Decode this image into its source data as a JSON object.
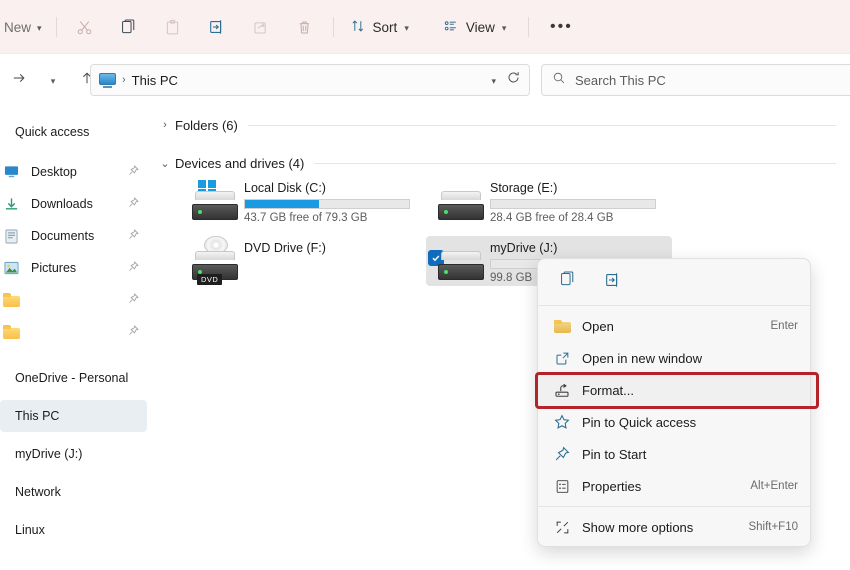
{
  "toolbar": {
    "new_label": "New",
    "new_icon": "chevron-down-icon",
    "cut_icon": "scissors-icon",
    "copy_icon": "copy-icon",
    "paste_icon": "paste-icon",
    "rename_icon": "rename-icon",
    "share_icon": "share-icon",
    "delete_icon": "trash-icon",
    "sort_label": "Sort",
    "sort_icon": "sort-arrows-icon",
    "view_label": "View",
    "view_icon": "view-list-icon",
    "more_label": "•••"
  },
  "addressbar": {
    "back_icon": "arrow-left-icon",
    "forward_icon": "arrow-right-icon",
    "recent_icon": "chevron-down-icon",
    "up_icon": "arrow-up-icon",
    "location_icon": "this-pc-icon",
    "crumb": "This PC",
    "crumb_separator": "›",
    "dropdown_icon": "chevron-down-icon",
    "refresh_icon": "refresh-icon"
  },
  "search": {
    "icon": "search-icon",
    "placeholder": "Search This PC"
  },
  "sidebar": {
    "items": [
      {
        "label": "Quick access",
        "icon": "none",
        "pinned": false,
        "selected": false
      },
      {
        "label": "Desktop",
        "icon": "desktop-icon",
        "pinned": true,
        "selected": false
      },
      {
        "label": "Downloads",
        "icon": "downloads-icon",
        "pinned": true,
        "selected": false
      },
      {
        "label": "Documents",
        "icon": "documents-icon",
        "pinned": true,
        "selected": false
      },
      {
        "label": "Pictures",
        "icon": "pictures-icon",
        "pinned": true,
        "selected": false
      },
      {
        "label": "",
        "icon": "folder-icon",
        "pinned": true,
        "selected": false
      },
      {
        "label": "",
        "icon": "folder-icon",
        "pinned": true,
        "selected": false
      },
      {
        "label": "OneDrive - Personal",
        "icon": "none",
        "pinned": false,
        "selected": false
      },
      {
        "label": "This PC",
        "icon": "none",
        "pinned": false,
        "selected": true
      },
      {
        "label": "myDrive (J:)",
        "icon": "none",
        "pinned": false,
        "selected": false
      },
      {
        "label": "Network",
        "icon": "none",
        "pinned": false,
        "selected": false
      },
      {
        "label": "Linux",
        "icon": "none",
        "pinned": false,
        "selected": false
      }
    ]
  },
  "content": {
    "groups": [
      {
        "title": "Folders (6)",
        "expanded": false,
        "chevron": "›"
      },
      {
        "title": "Devices and drives (4)",
        "expanded": true,
        "chevron": "⌄"
      }
    ],
    "drives": [
      {
        "name": "Local Disk (C:)",
        "icon": "windows-drive-icon",
        "sub": "43.7 GB free of 79.3 GB",
        "used_percent": 45,
        "show_bar": true,
        "selected": false,
        "checked": false
      },
      {
        "name": "Storage (E:)",
        "icon": "drive-icon",
        "sub": "28.4 GB free of 28.4 GB",
        "used_percent": 0,
        "show_bar": true,
        "selected": false,
        "checked": false
      },
      {
        "name": "DVD Drive (F:)",
        "icon": "dvd-drive-icon",
        "sub": "",
        "used_percent": 0,
        "show_bar": false,
        "selected": false,
        "checked": false,
        "badge": "DVD"
      },
      {
        "name": "myDrive (J:)",
        "icon": "drive-icon",
        "sub": "99.8 GB",
        "used_percent": 0,
        "show_bar": true,
        "selected": true,
        "checked": true
      }
    ]
  },
  "context_menu": {
    "top_actions": [
      {
        "name": "copy",
        "icon": "copy-icon"
      },
      {
        "name": "rename",
        "icon": "rename-icon"
      }
    ],
    "items": [
      {
        "label": "Open",
        "icon": "folder-open-icon",
        "shortcut": "Enter",
        "highlighted": false
      },
      {
        "label": "Open in new window",
        "icon": "new-window-icon",
        "shortcut": "",
        "highlighted": false
      },
      {
        "label": "Format...",
        "icon": "format-icon",
        "shortcut": "",
        "highlighted": true
      },
      {
        "label": "Pin to Quick access",
        "icon": "star-icon",
        "shortcut": "",
        "highlighted": false
      },
      {
        "label": "Pin to Start",
        "icon": "pin-icon",
        "shortcut": "",
        "highlighted": false
      },
      {
        "label": "Properties",
        "icon": "properties-icon",
        "shortcut": "Alt+Enter",
        "highlighted": false
      },
      {
        "label": "Show more options",
        "icon": "show-more-icon",
        "shortcut": "Shift+F10",
        "highlighted": false
      }
    ]
  },
  "annotation": {
    "highlight_color": "#b4232a",
    "target": "Format..."
  }
}
